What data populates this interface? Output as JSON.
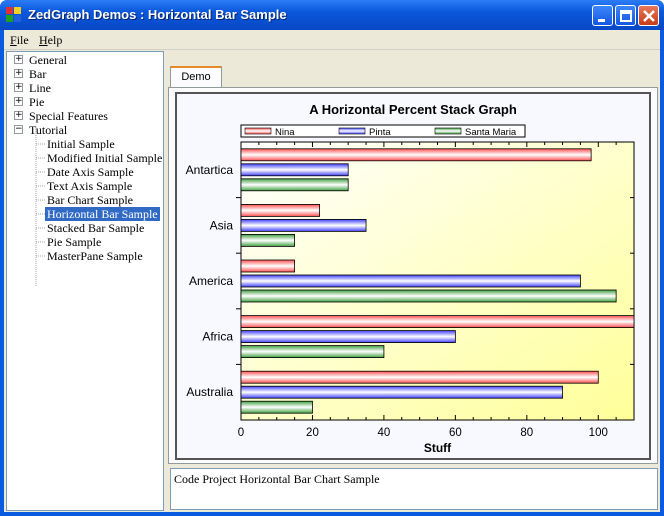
{
  "window": {
    "title": "ZedGraph Demos : Horizontal Bar Sample"
  },
  "menu": [
    {
      "label": "File",
      "accel": "F",
      "rest": "ile"
    },
    {
      "label": "Help",
      "accel": "H",
      "rest": "elp"
    }
  ],
  "tree": {
    "top_items": [
      "General",
      "Bar",
      "Line",
      "Pie",
      "Special Features",
      "Tutorial"
    ],
    "tutorial_children": [
      "Initial Sample",
      "Modified Initial Sample",
      "Date Axis Sample",
      "Text Axis Sample",
      "Bar Chart Sample",
      "Horizontal Bar Sample",
      "Stacked Bar Sample",
      "Pie Sample",
      "MasterPane Sample"
    ],
    "selected": "Horizontal Bar Sample"
  },
  "tabs": [
    {
      "label": "Demo"
    }
  ],
  "description": "Code Project Horizontal Bar Chart Sample",
  "colors": {
    "titlebar": "#0a5be0",
    "selection": "#316ac5",
    "series_red": "#ff5050",
    "series_blue": "#4040ff",
    "series_green": "#40a040",
    "chart_fill_start": "#ffffff",
    "chart_fill_end": "#ffff99"
  },
  "chart_data": {
    "type": "bar",
    "orientation": "horizontal",
    "title": "A Horizontal Percent Stack Graph",
    "xlabel": "Stuff",
    "ylabel": "",
    "xlim": [
      0,
      110
    ],
    "xticks": [
      0,
      20,
      40,
      60,
      80,
      100
    ],
    "categories": [
      "Australia",
      "Africa",
      "America",
      "Asia",
      "Antartica"
    ],
    "series": [
      {
        "name": "Nina",
        "color": "#ff5050",
        "values": [
          100,
          110,
          15,
          22,
          98
        ]
      },
      {
        "name": "Pinta",
        "color": "#4040ff",
        "values": [
          90,
          60,
          95,
          35,
          30
        ]
      },
      {
        "name": "Santa Maria",
        "color": "#40a040",
        "values": [
          20,
          40,
          105,
          15,
          30
        ]
      }
    ],
    "legend_position": "top",
    "grid": false
  }
}
